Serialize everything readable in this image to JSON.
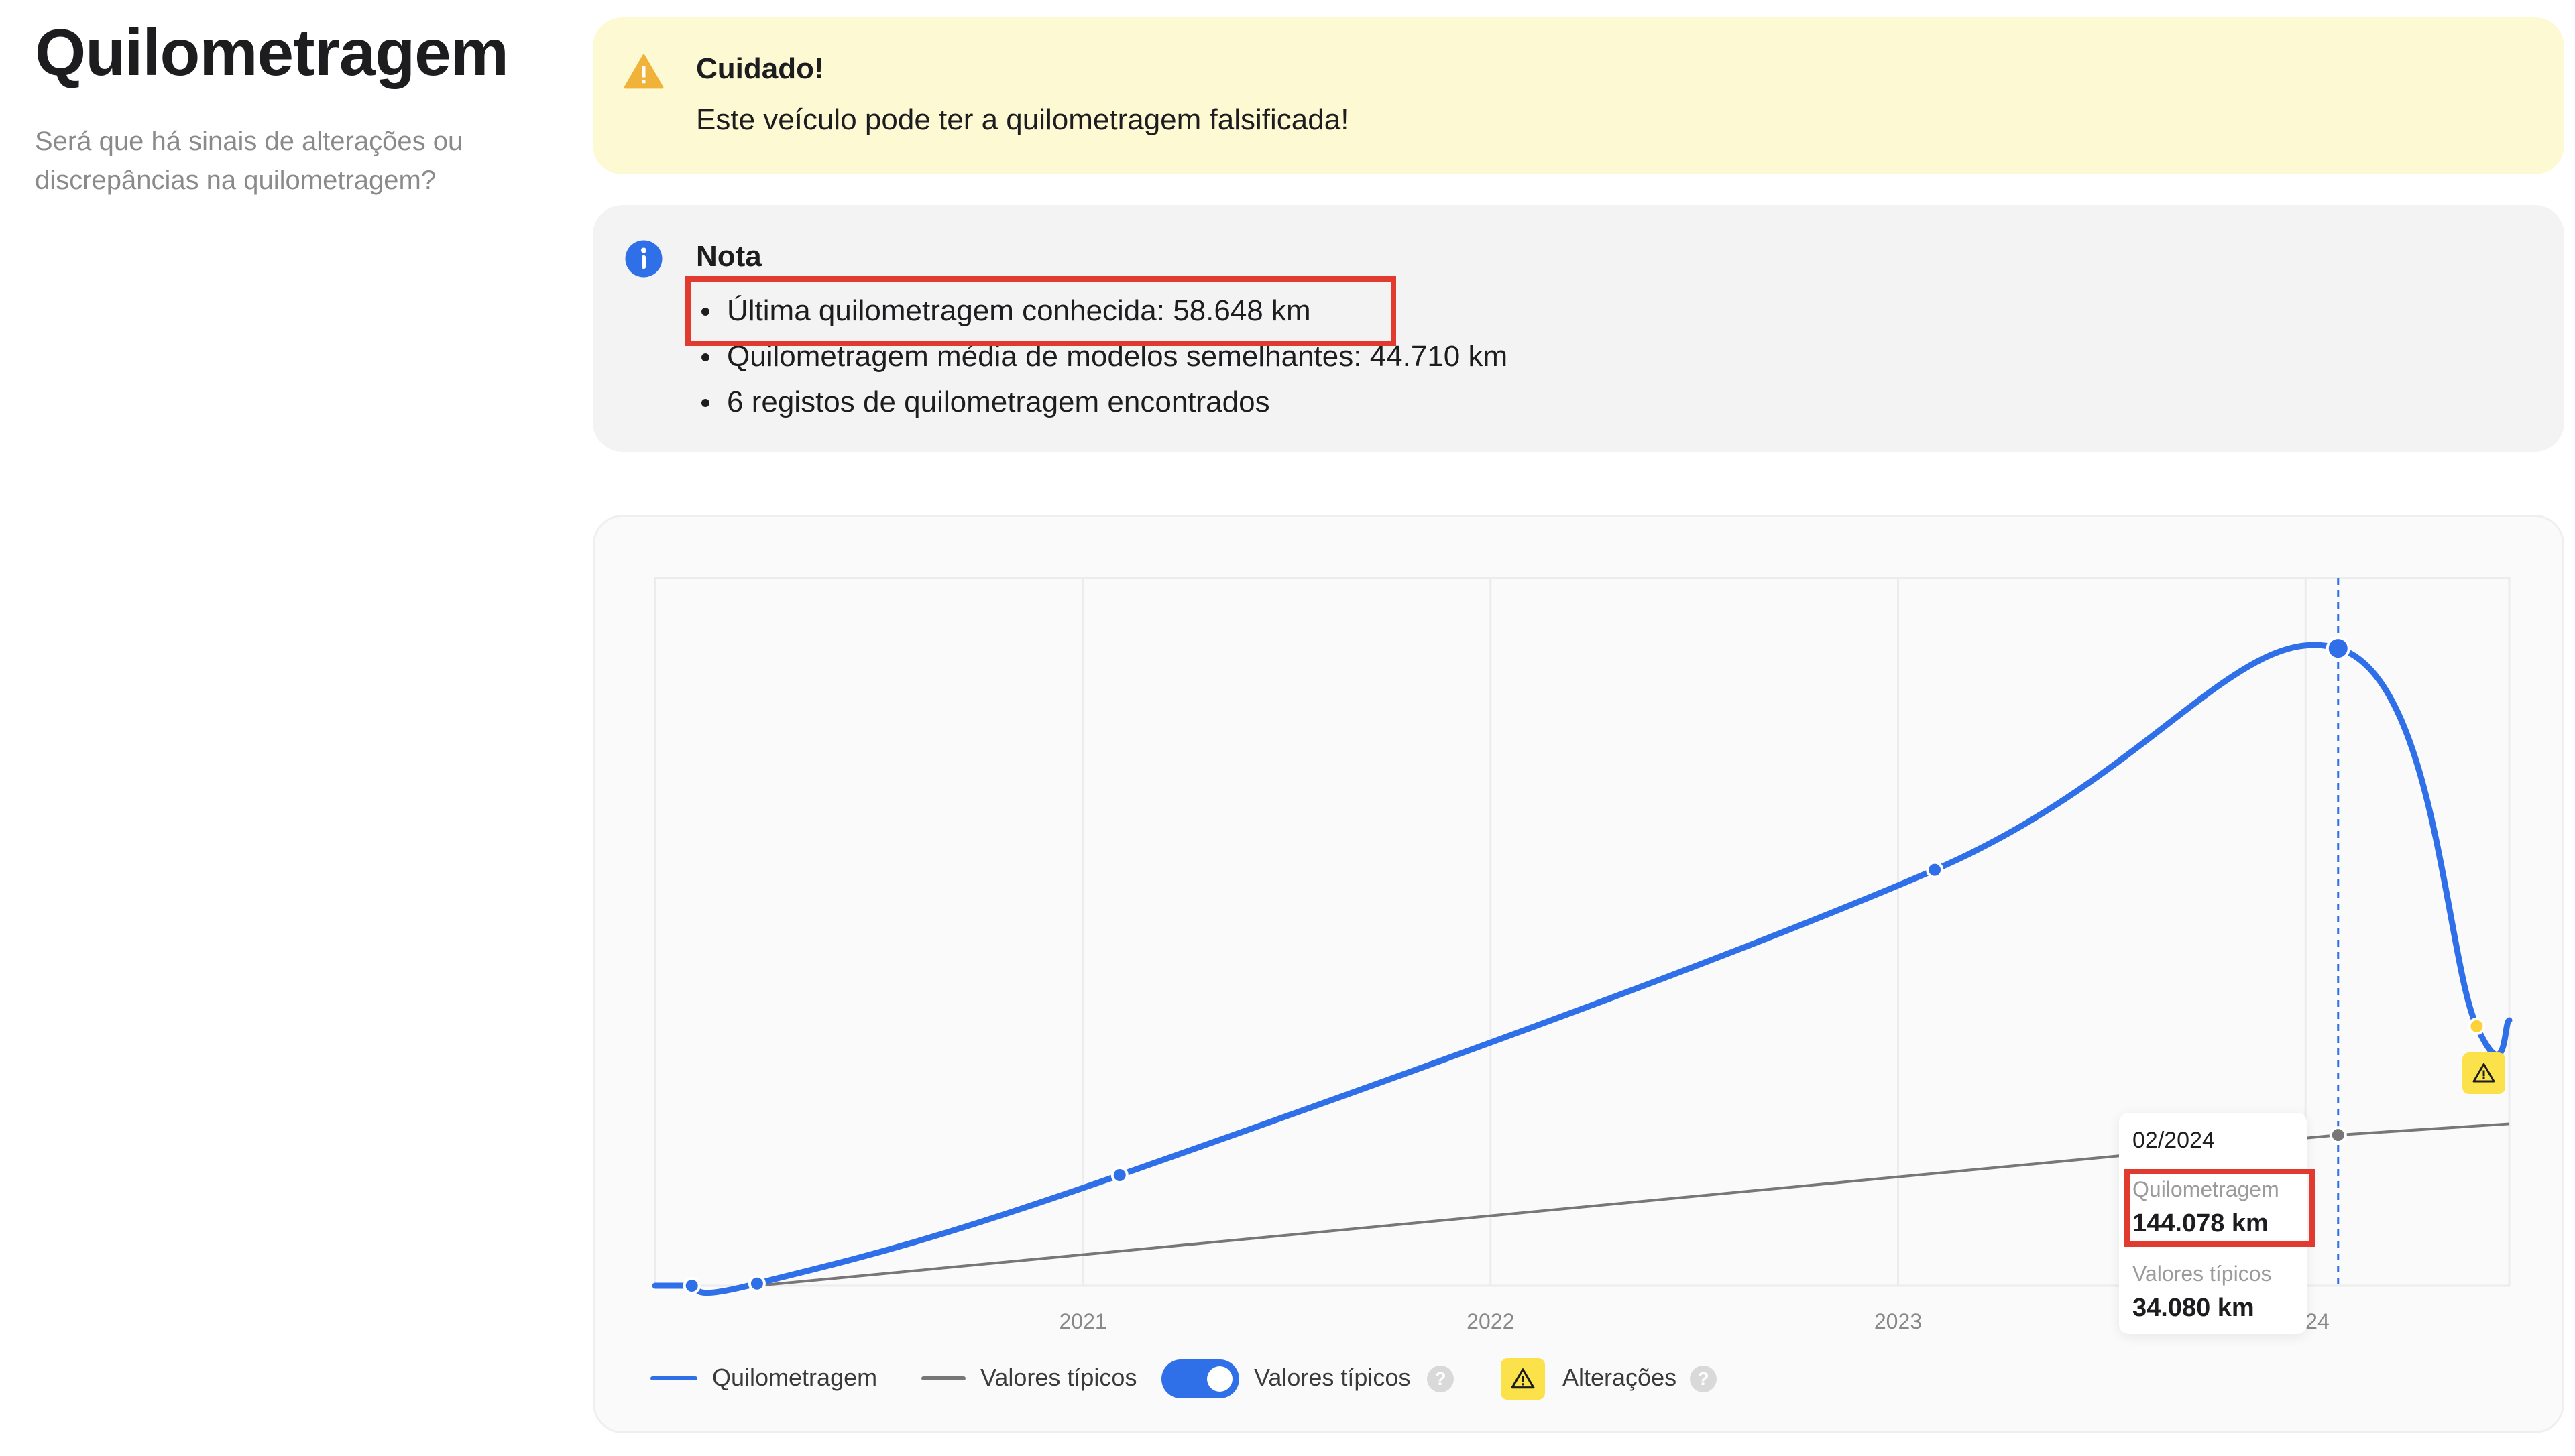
{
  "header": {
    "title": "Quilometragem",
    "subtitle": "Será que há sinais de alterações ou discrepâncias na quilometragem?"
  },
  "warning": {
    "icon": "warning-triangle-icon",
    "title": "Cuidado!",
    "text": "Este veículo pode ter a quilometragem falsificada!"
  },
  "note": {
    "icon": "info-icon",
    "title": "Nota",
    "items": [
      "Última quilometragem conhecida: 58.648 km",
      "Quilometragem média de modelos semelhantes: 44.710 km",
      "6 registos de quilometragem encontrados"
    ]
  },
  "colors": {
    "accent": "#2f6fe8",
    "typical": "#777777",
    "warning": "#fbe24b",
    "highlight": "#e13b30"
  },
  "chart_data": {
    "type": "line",
    "series": [
      {
        "name": "Quilometragem",
        "points": [
          {
            "x": 2020.04,
            "y": 0
          },
          {
            "x": 2020.2,
            "y": 500
          },
          {
            "x": 2021.09,
            "y": 25000
          },
          {
            "x": 2023.09,
            "y": 94000
          },
          {
            "x": 2024.08,
            "y": 144078
          },
          {
            "x": 2024.42,
            "y": 58648
          },
          {
            "x": 2024.5,
            "y": 60000
          }
        ]
      },
      {
        "name": "Valores típicos",
        "points": [
          {
            "x": 2020.2,
            "y": 0
          },
          {
            "x": 2024.08,
            "y": 34080
          },
          {
            "x": 2024.5,
            "y": 36600
          }
        ]
      }
    ],
    "x_ticks": [
      "2021",
      "2022",
      "2023",
      "2024"
    ],
    "xlim": [
      2019.95,
      2024.5
    ],
    "ylim": [
      0,
      160000
    ],
    "grid": true,
    "highlighted_point": {
      "x": 2024.08
    },
    "tooltip": {
      "date": "02/2024",
      "series1_label": "Quilometragem",
      "series1_value": "144.078 km",
      "series2_label": "Valores típicos",
      "series2_value": "34.080 km"
    },
    "legend": {
      "series1": "Quilometragem",
      "series2": "Valores típicos",
      "toggle_label": "Valores típicos",
      "toggle_on": true,
      "changes_label": "Alterações",
      "help_glyph": "?"
    }
  }
}
